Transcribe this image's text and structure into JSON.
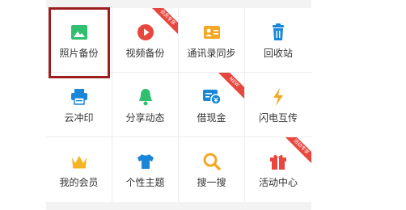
{
  "colors": {
    "highlight": "#9c1d1c",
    "ribbon": "#e8473f"
  },
  "items": [
    {
      "label": "照片备份",
      "icon": "photo-icon"
    },
    {
      "label": "视频备份",
      "icon": "play-icon",
      "badge": "会员专享"
    },
    {
      "label": "通讯录同步",
      "icon": "contacts-card-icon"
    },
    {
      "label": "回收站",
      "icon": "trash-icon"
    },
    {
      "label": "云冲印",
      "icon": "printer-icon"
    },
    {
      "label": "分享动态",
      "icon": "bell-icon"
    },
    {
      "label": "借现金",
      "icon": "cash-card-icon",
      "badge": "NEW"
    },
    {
      "label": "闪电互传",
      "icon": "lightning-icon"
    },
    {
      "label": "我的会员",
      "icon": "crown-icon"
    },
    {
      "label": "个性主题",
      "icon": "tshirt-icon"
    },
    {
      "label": "搜一搜",
      "icon": "search-icon"
    },
    {
      "label": "活动中心",
      "icon": "gift-icon",
      "badge": "活动专享"
    }
  ]
}
